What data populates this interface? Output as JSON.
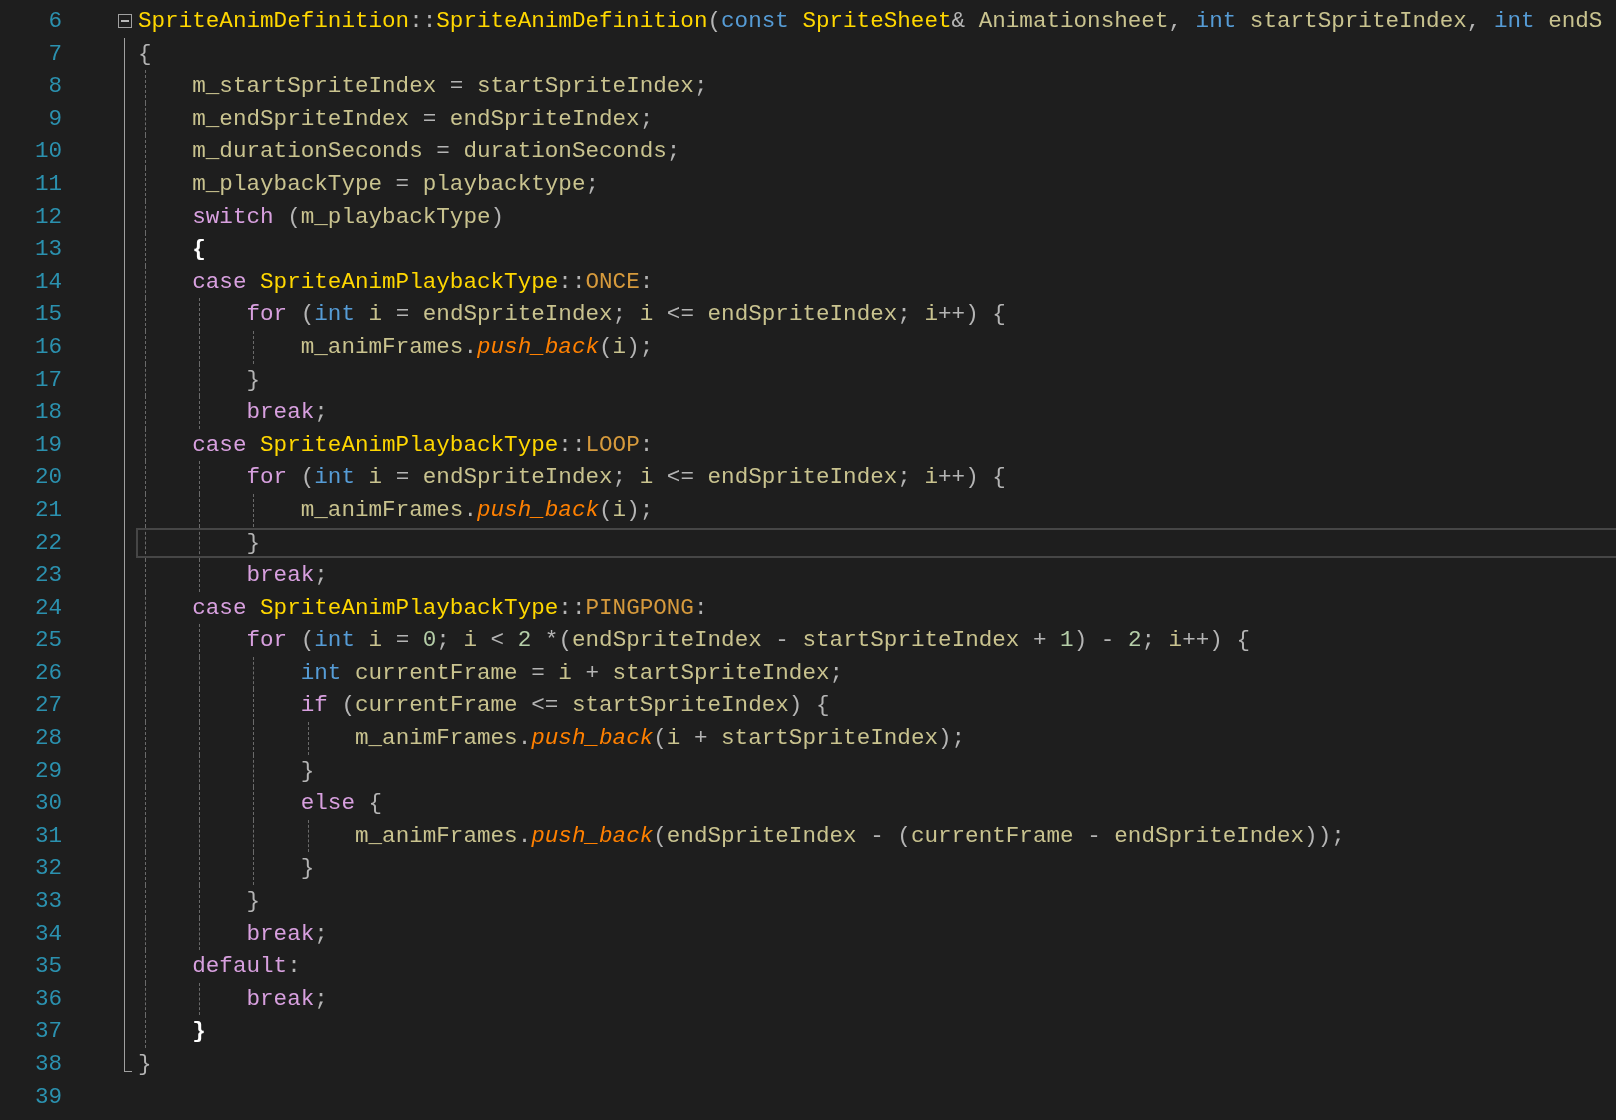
{
  "editor": {
    "lines": [
      {
        "number": "6",
        "current": false,
        "expanded": true,
        "tokens": [
          {
            "kind": "type",
            "text": "SpriteAnimDefinition"
          },
          {
            "kind": "punct",
            "text": "::"
          },
          {
            "kind": "type",
            "text": "SpriteAnimDefinition"
          },
          {
            "kind": "punct",
            "text": "("
          },
          {
            "kind": "keyword",
            "text": "const"
          },
          {
            "kind": "type",
            "text": " SpriteSheet"
          },
          {
            "kind": "punct",
            "text": "& "
          },
          {
            "kind": "var",
            "text": "Animationsheet"
          },
          {
            "kind": "punct",
            "text": ", "
          },
          {
            "kind": "keyword",
            "text": "int"
          },
          {
            "kind": "var",
            "text": " startSpriteIndex"
          },
          {
            "kind": "punct",
            "text": ", "
          },
          {
            "kind": "keyword",
            "text": "int"
          },
          {
            "kind": "var",
            "text": " endS"
          }
        ]
      },
      {
        "number": "7",
        "current": false,
        "tokens": [
          {
            "kind": "punct",
            "text": "{"
          }
        ],
        "children": [
          {
            "number": "8",
            "current": false,
            "tokens": [
              {
                "kind": "var",
                "text": "m_startSpriteIndex"
              },
              {
                "kind": "punct",
                "text": " = "
              },
              {
                "kind": "var",
                "text": "startSpriteIndex"
              },
              {
                "kind": "punct",
                "text": ";"
              }
            ]
          },
          {
            "number": "9",
            "current": false,
            "tokens": [
              {
                "kind": "var",
                "text": "m_endSpriteIndex"
              },
              {
                "kind": "punct",
                "text": " = "
              },
              {
                "kind": "var",
                "text": "endSpriteIndex"
              },
              {
                "kind": "punct",
                "text": ";"
              }
            ]
          },
          {
            "number": "10",
            "current": false,
            "tokens": [
              {
                "kind": "var",
                "text": "m_durationSeconds"
              },
              {
                "kind": "punct",
                "text": " = "
              },
              {
                "kind": "var",
                "text": "durationSeconds"
              },
              {
                "kind": "punct",
                "text": ";"
              }
            ]
          },
          {
            "number": "11",
            "current": false,
            "tokens": [
              {
                "kind": "var",
                "text": "m_playbackType"
              },
              {
                "kind": "punct",
                "text": " = "
              },
              {
                "kind": "var",
                "text": "playbacktype"
              },
              {
                "kind": "punct",
                "text": ";"
              }
            ]
          },
          {
            "number": "12",
            "current": false,
            "tokens": [
              {
                "kind": "control",
                "text": "switch"
              },
              {
                "kind": "punct",
                "text": " ("
              },
              {
                "kind": "var",
                "text": "m_playbackType"
              },
              {
                "kind": "punct",
                "text": ")"
              }
            ]
          },
          {
            "number": "13",
            "current": false,
            "tokens": [
              {
                "kind": "match",
                "text": "{"
              }
            ]
          },
          {
            "number": "14",
            "current": false,
            "tokens": [
              {
                "kind": "control",
                "text": "case"
              },
              {
                "kind": "type",
                "text": " SpriteAnimPlaybackType"
              },
              {
                "kind": "punct",
                "text": "::"
              },
              {
                "kind": "enum",
                "text": "ONCE"
              },
              {
                "kind": "punct",
                "text": ":"
              }
            ],
            "children": [
              {
                "number": "15",
                "current": false,
                "tokens": [
                  {
                    "kind": "control",
                    "text": "for"
                  },
                  {
                    "kind": "punct",
                    "text": " ("
                  },
                  {
                    "kind": "keyword",
                    "text": "int"
                  },
                  {
                    "kind": "var",
                    "text": " i"
                  },
                  {
                    "kind": "punct",
                    "text": " = "
                  },
                  {
                    "kind": "var",
                    "text": "endSpriteIndex"
                  },
                  {
                    "kind": "punct",
                    "text": "; "
                  },
                  {
                    "kind": "var",
                    "text": "i"
                  },
                  {
                    "kind": "punct",
                    "text": " <= "
                  },
                  {
                    "kind": "var",
                    "text": "endSpriteIndex"
                  },
                  {
                    "kind": "punct",
                    "text": "; "
                  },
                  {
                    "kind": "var",
                    "text": "i"
                  },
                  {
                    "kind": "punct",
                    "text": "++) {"
                  }
                ],
                "children": [
                  {
                    "number": "16",
                    "current": false,
                    "tokens": [
                      {
                        "kind": "var",
                        "text": "m_animFrames"
                      },
                      {
                        "kind": "punct",
                        "text": "."
                      },
                      {
                        "kind": "func",
                        "text": "push_back"
                      },
                      {
                        "kind": "punct",
                        "text": "("
                      },
                      {
                        "kind": "var",
                        "text": "i"
                      },
                      {
                        "kind": "punct",
                        "text": ");"
                      }
                    ]
                  }
                ]
              },
              {
                "number": "17",
                "current": false,
                "tokens": [
                  {
                    "kind": "punct",
                    "text": "}"
                  }
                ]
              },
              {
                "number": "18",
                "current": false,
                "tokens": [
                  {
                    "kind": "control",
                    "text": "break"
                  },
                  {
                    "kind": "punct",
                    "text": ";"
                  }
                ]
              }
            ]
          },
          {
            "number": "19",
            "current": false,
            "tokens": [
              {
                "kind": "control",
                "text": "case"
              },
              {
                "kind": "type",
                "text": " SpriteAnimPlaybackType"
              },
              {
                "kind": "punct",
                "text": "::"
              },
              {
                "kind": "enum",
                "text": "LOOP"
              },
              {
                "kind": "punct",
                "text": ":"
              }
            ],
            "children": [
              {
                "number": "20",
                "current": false,
                "tokens": [
                  {
                    "kind": "control",
                    "text": "for"
                  },
                  {
                    "kind": "punct",
                    "text": " ("
                  },
                  {
                    "kind": "keyword",
                    "text": "int"
                  },
                  {
                    "kind": "var",
                    "text": " i"
                  },
                  {
                    "kind": "punct",
                    "text": " = "
                  },
                  {
                    "kind": "var",
                    "text": "endSpriteIndex"
                  },
                  {
                    "kind": "punct",
                    "text": "; "
                  },
                  {
                    "kind": "var",
                    "text": "i"
                  },
                  {
                    "kind": "punct",
                    "text": " <= "
                  },
                  {
                    "kind": "var",
                    "text": "endSpriteIndex"
                  },
                  {
                    "kind": "punct",
                    "text": "; "
                  },
                  {
                    "kind": "var",
                    "text": "i"
                  },
                  {
                    "kind": "punct",
                    "text": "++) {"
                  }
                ],
                "children": [
                  {
                    "number": "21",
                    "current": false,
                    "tokens": [
                      {
                        "kind": "var",
                        "text": "m_animFrames"
                      },
                      {
                        "kind": "punct",
                        "text": "."
                      },
                      {
                        "kind": "func",
                        "text": "push_back"
                      },
                      {
                        "kind": "punct",
                        "text": "("
                      },
                      {
                        "kind": "var",
                        "text": "i"
                      },
                      {
                        "kind": "punct",
                        "text": ");"
                      }
                    ]
                  }
                ]
              },
              {
                "number": "22",
                "current": true,
                "tokens": [
                  {
                    "kind": "punct",
                    "text": "}"
                  }
                ]
              },
              {
                "number": "23",
                "current": false,
                "tokens": [
                  {
                    "kind": "control",
                    "text": "break"
                  },
                  {
                    "kind": "punct",
                    "text": ";"
                  }
                ]
              }
            ]
          },
          {
            "number": "24",
            "current": false,
            "tokens": [
              {
                "kind": "control",
                "text": "case"
              },
              {
                "kind": "type",
                "text": " SpriteAnimPlaybackType"
              },
              {
                "kind": "punct",
                "text": "::"
              },
              {
                "kind": "enum",
                "text": "PINGPONG"
              },
              {
                "kind": "punct",
                "text": ":"
              }
            ],
            "children": [
              {
                "number": "25",
                "current": false,
                "tokens": [
                  {
                    "kind": "control",
                    "text": "for"
                  },
                  {
                    "kind": "punct",
                    "text": " ("
                  },
                  {
                    "kind": "keyword",
                    "text": "int"
                  },
                  {
                    "kind": "var",
                    "text": " i"
                  },
                  {
                    "kind": "punct",
                    "text": " = "
                  },
                  {
                    "kind": "number",
                    "text": "0"
                  },
                  {
                    "kind": "punct",
                    "text": "; "
                  },
                  {
                    "kind": "var",
                    "text": "i"
                  },
                  {
                    "kind": "punct",
                    "text": " < "
                  },
                  {
                    "kind": "number",
                    "text": "2"
                  },
                  {
                    "kind": "punct",
                    "text": " *("
                  },
                  {
                    "kind": "var",
                    "text": "endSpriteIndex"
                  },
                  {
                    "kind": "punct",
                    "text": " - "
                  },
                  {
                    "kind": "var",
                    "text": "startSpriteIndex"
                  },
                  {
                    "kind": "punct",
                    "text": " + "
                  },
                  {
                    "kind": "number",
                    "text": "1"
                  },
                  {
                    "kind": "punct",
                    "text": ") - "
                  },
                  {
                    "kind": "number",
                    "text": "2"
                  },
                  {
                    "kind": "punct",
                    "text": "; "
                  },
                  {
                    "kind": "var",
                    "text": "i"
                  },
                  {
                    "kind": "punct",
                    "text": "++) {"
                  }
                ],
                "children": [
                  {
                    "number": "26",
                    "current": false,
                    "tokens": [
                      {
                        "kind": "keyword",
                        "text": "int"
                      },
                      {
                        "kind": "var",
                        "text": " currentFrame"
                      },
                      {
                        "kind": "punct",
                        "text": " = "
                      },
                      {
                        "kind": "var",
                        "text": "i"
                      },
                      {
                        "kind": "punct",
                        "text": " + "
                      },
                      {
                        "kind": "var",
                        "text": "startSpriteIndex"
                      },
                      {
                        "kind": "punct",
                        "text": ";"
                      }
                    ]
                  },
                  {
                    "number": "27",
                    "current": false,
                    "tokens": [
                      {
                        "kind": "control",
                        "text": "if"
                      },
                      {
                        "kind": "punct",
                        "text": " ("
                      },
                      {
                        "kind": "var",
                        "text": "currentFrame"
                      },
                      {
                        "kind": "punct",
                        "text": " <= "
                      },
                      {
                        "kind": "var",
                        "text": "startSpriteIndex"
                      },
                      {
                        "kind": "punct",
                        "text": ") {"
                      }
                    ],
                    "children": [
                      {
                        "number": "28",
                        "current": false,
                        "tokens": [
                          {
                            "kind": "var",
                            "text": "m_animFrames"
                          },
                          {
                            "kind": "punct",
                            "text": "."
                          },
                          {
                            "kind": "func",
                            "text": "push_back"
                          },
                          {
                            "kind": "punct",
                            "text": "("
                          },
                          {
                            "kind": "var",
                            "text": "i"
                          },
                          {
                            "kind": "punct",
                            "text": " + "
                          },
                          {
                            "kind": "var",
                            "text": "startSpriteIndex"
                          },
                          {
                            "kind": "punct",
                            "text": ");"
                          }
                        ]
                      }
                    ]
                  },
                  {
                    "number": "29",
                    "current": false,
                    "tokens": [
                      {
                        "kind": "punct",
                        "text": "}"
                      }
                    ]
                  },
                  {
                    "number": "30",
                    "current": false,
                    "tokens": [
                      {
                        "kind": "control",
                        "text": "else"
                      },
                      {
                        "kind": "punct",
                        "text": " {"
                      }
                    ],
                    "children": [
                      {
                        "number": "31",
                        "current": false,
                        "tokens": [
                          {
                            "kind": "var",
                            "text": "m_animFrames"
                          },
                          {
                            "kind": "punct",
                            "text": "."
                          },
                          {
                            "kind": "func",
                            "text": "push_back"
                          },
                          {
                            "kind": "punct",
                            "text": "("
                          },
                          {
                            "kind": "var",
                            "text": "endSpriteIndex"
                          },
                          {
                            "kind": "punct",
                            "text": " - ("
                          },
                          {
                            "kind": "var",
                            "text": "currentFrame"
                          },
                          {
                            "kind": "punct",
                            "text": " - "
                          },
                          {
                            "kind": "var",
                            "text": "endSpriteIndex"
                          },
                          {
                            "kind": "punct",
                            "text": "));"
                          }
                        ]
                      }
                    ]
                  },
                  {
                    "number": "32",
                    "current": false,
                    "tokens": [
                      {
                        "kind": "punct",
                        "text": "}"
                      }
                    ]
                  }
                ]
              },
              {
                "number": "33",
                "current": false,
                "tokens": [
                  {
                    "kind": "punct",
                    "text": "}"
                  }
                ]
              },
              {
                "number": "34",
                "current": false,
                "tokens": [
                  {
                    "kind": "control",
                    "text": "break"
                  },
                  {
                    "kind": "punct",
                    "text": ";"
                  }
                ]
              }
            ]
          },
          {
            "number": "35",
            "current": false,
            "tokens": [
              {
                "kind": "control",
                "text": "default"
              },
              {
                "kind": "punct",
                "text": ":"
              }
            ],
            "children": [
              {
                "number": "36",
                "current": false,
                "tokens": [
                  {
                    "kind": "control",
                    "text": "break"
                  },
                  {
                    "kind": "punct",
                    "text": ";"
                  }
                ]
              }
            ]
          },
          {
            "number": "37",
            "current": false,
            "tokens": [
              {
                "kind": "match",
                "text": "}"
              }
            ]
          }
        ]
      },
      {
        "number": "38",
        "current": false,
        "tokens": [
          {
            "kind": "punct",
            "text": "}"
          }
        ]
      },
      {
        "number": "39",
        "current": false
      }
    ]
  }
}
